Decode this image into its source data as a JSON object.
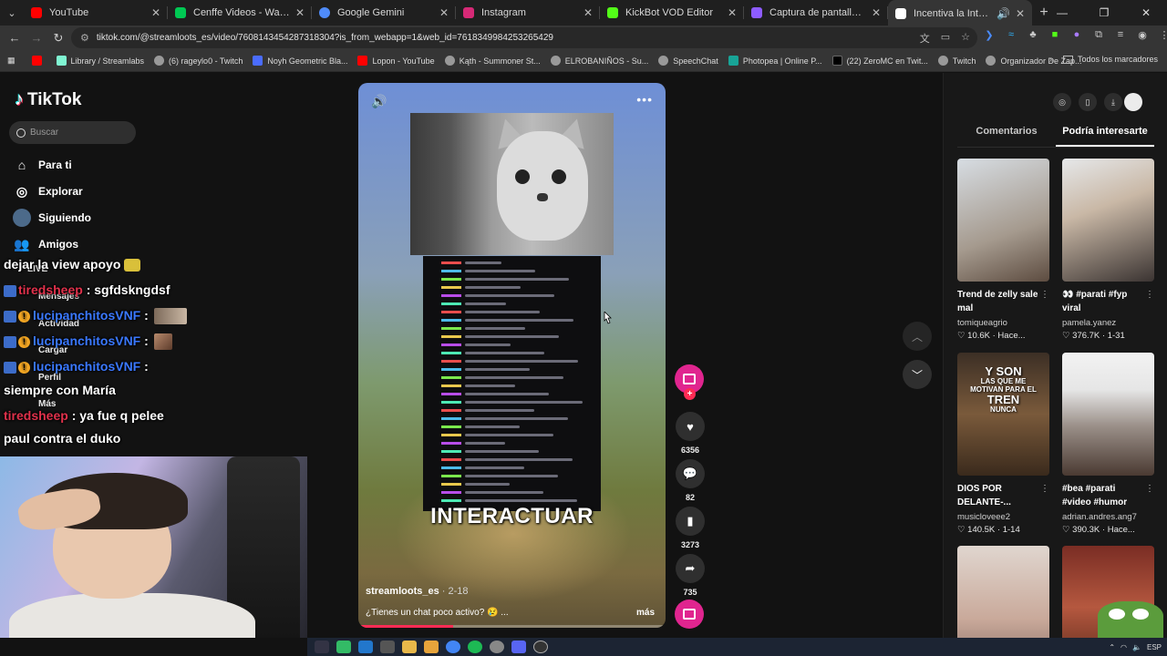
{
  "browser": {
    "tabs": [
      {
        "title": "YouTube",
        "color": "#ff0000"
      },
      {
        "title": "Cenffe Videos - Watch On",
        "color": "#00c853"
      },
      {
        "title": "Google Gemini",
        "color": "#4f8bf9"
      },
      {
        "title": "Instagram",
        "color": "#d62976"
      },
      {
        "title": "KickBot VOD Editor",
        "color": "#53fc18"
      },
      {
        "title": "Captura de pantalla por Lightsh",
        "color": "#8e5cff"
      },
      {
        "title": "Incentiva la Interacción en",
        "color": "#ffffff",
        "active": true
      }
    ],
    "url": "tiktok.com/@streamloots_es/video/7608143454287318304?is_from_webapp=1&web_id=7618349984253265429",
    "bookmarks": [
      {
        "label": "",
        "color": "#ff0000"
      },
      {
        "label": "Library / Streamlabs",
        "color": "#80f5d2"
      },
      {
        "label": "(6) rageylo0 - Twitch",
        "color": "#9146ff"
      },
      {
        "label": "Noyh Geometric Bla...",
        "color": "#4a6cff"
      },
      {
        "label": "Lopon - YouTube",
        "color": "#ff0000"
      },
      {
        "label": "Kąth - Summoner St...",
        "color": "#999999"
      },
      {
        "label": "ELROBANIÑOS - Su...",
        "color": "#999999"
      },
      {
        "label": "SpeechChat",
        "color": "#999999"
      },
      {
        "label": "Photopea | Online P...",
        "color": "#18a497"
      },
      {
        "label": "(22) ZeroMC en Twit...",
        "color": "#000000"
      },
      {
        "label": "Twitch",
        "color": "#999999"
      },
      {
        "label": "Organizador De Zap...",
        "color": "#999999"
      }
    ],
    "all_bookmarks": "Todos los marcadores"
  },
  "sidebar": {
    "brand": "TikTok",
    "search_placeholder": "Buscar",
    "nav": [
      {
        "label": "Para ti",
        "icon": "home-icon"
      },
      {
        "label": "Explorar",
        "icon": "compass-icon"
      },
      {
        "label": "Siguiendo",
        "icon": "following-avatar-icon"
      },
      {
        "label": "Amigos",
        "icon": "friends-icon"
      },
      {
        "label": "LIVE",
        "icon": "live-icon"
      },
      {
        "label": "Mensajes",
        "icon": "messages-icon"
      },
      {
        "label": "Actividad",
        "icon": "activity-icon"
      },
      {
        "label": "Cargar",
        "icon": "upload-icon"
      },
      {
        "label": "Perfil",
        "icon": "profile-icon"
      },
      {
        "label": "Más",
        "icon": "more-icon"
      }
    ]
  },
  "overlay_chat": [
    {
      "user": "",
      "text": "dejar la view apoyo"
    },
    {
      "user": "tiredsheep",
      "text": ": sgfdskngdsf"
    },
    {
      "user": "lucipanchitosVNF",
      "text": ":"
    },
    {
      "user": "lucipanchitosVNF",
      "text": ":"
    },
    {
      "user": "lucipanchitosVNF",
      "text": ":"
    },
    {
      "user": "",
      "text": "siempre con María"
    },
    {
      "user": "tiredsheep",
      "text": ": ya fue q pelee"
    },
    {
      "user": "",
      "text": "paul contra el duko"
    }
  ],
  "video": {
    "overlay_text": "INTERACTUAR",
    "author": "streamloots_es",
    "date": "· 2-18",
    "caption": "¿Tienes un chat poco activo? 😢 ...",
    "more": "más",
    "progress": 0.31
  },
  "actions": {
    "likes": "6356",
    "comments": "82",
    "saves": "3273",
    "shares": "735"
  },
  "right_panel": {
    "tabs": [
      "Comentarios",
      "Podría interesarte"
    ],
    "active_tab": 1,
    "cards": [
      {
        "title": "Trend de zelly sale mal",
        "author": "tomiqueagrio",
        "stats": "♡ 10.6K · Hace..."
      },
      {
        "title": "👀 #parati #fyp viral",
        "author": "pamela.yanez",
        "stats": "♡ 376.7K · 1-31"
      },
      {
        "title": "DIOS POR DELANTE-...",
        "author": "musicloveee2",
        "stats": "♡ 140.5K · 1-14",
        "overlay": [
          "Y SON",
          "LAS QUE ME",
          "MOTIVAN PARA EL",
          "TREN",
          "NUNCA"
        ]
      },
      {
        "title": "#bea #parati #video #humor",
        "author": "adrian.andres.ang7",
        "stats": "♡ 390.3K · Hace..."
      },
      {
        "title": "",
        "author": "",
        "stats": ""
      },
      {
        "title": "",
        "author": "",
        "stats": ""
      }
    ]
  },
  "taskbar": {
    "lang": "ESP"
  }
}
